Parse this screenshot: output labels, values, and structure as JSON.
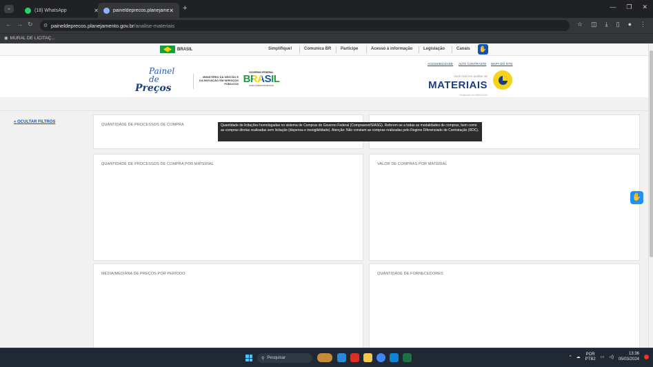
{
  "browser": {
    "tabs": [
      {
        "label": "(18) WhatsApp",
        "active": false
      },
      {
        "label": "paineldeprecos.planejamento.g",
        "active": false
      }
    ],
    "url_host": "paineldeprecos.planejamento.gov.br",
    "url_path": "/analise-materiais",
    "bookmark": "MURAL DE LICITAÇ..."
  },
  "gov_bar": {
    "brasil": "BRASIL",
    "links": [
      "Simplifique!",
      "Comunica BR",
      "Participe",
      "Acesso à informação",
      "Legislação",
      "Canais"
    ]
  },
  "header": {
    "logo_line1": "Painel de",
    "logo_line2": "Preços",
    "ministerio": "MINISTÉRIO DA GESTÃO E DA INOVAÇÃO EM SERVIÇOS PÚBLICOS",
    "gov_federal": "GOVERNO FEDERAL",
    "brasil_big": "BRASIL",
    "brasil_sub": "UNIÃO E RECONSTRUÇÃO",
    "top_links": [
      "ACESSIBILIDADE",
      "ALTO CONTRASTE",
      "MAPA DO SITE"
    ],
    "voce_esta": "Você está em análise de",
    "section": "MATERIAIS",
    "atualizado": "Atualizado em 05/03/2024"
  },
  "filters": {
    "toggle_label": "« OCULTAR FILTROS"
  },
  "cards": [
    {
      "title": "QUANTIDADE DE PROCESSOS DE COMPRA"
    },
    {
      "title": ""
    },
    {
      "title": "QUANTIDADE DE PROCESSOS DE COMPRA POR MATERIAL"
    },
    {
      "title": "VALOR DE COMPRAS POR MATERIAL"
    },
    {
      "title": "MÉDIA/MEDIANA DE PREÇOS POR PERÍODO"
    },
    {
      "title": "QUANTIDADE DE FORNECEDORES"
    }
  ],
  "tooltip": "Quantidade de licitações homologadas no sistema de Compras do Governo Federal (Comprasnet/SIASG). Referem-se a todas as modalidades de compras, bem como as compras diretas realizadas sem licitação (dispensa e inexigibilidade). Atenção: Não constam as compras realizadas pelo Regime Diferenciado de Contratação (RDC).",
  "taskbar": {
    "search_placeholder": "Pesquisar",
    "lang_line1": "POR",
    "lang_line2": "PTB2",
    "time": "13:36",
    "date": "05/03/2024"
  },
  "colors": {
    "gov_blue": "#1351b4",
    "brand_navy": "#1a3e7e",
    "accent_yellow": "#f5d31a"
  }
}
